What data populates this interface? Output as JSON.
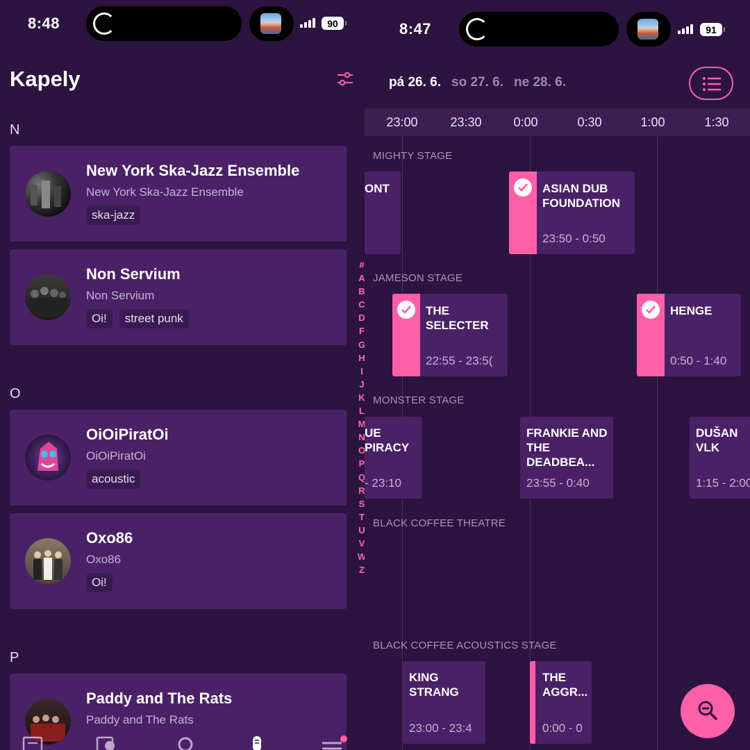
{
  "left": {
    "status": {
      "time": "8:48",
      "battery": "90"
    },
    "title": "Kapely",
    "sections": [
      {
        "letter": "N"
      },
      {
        "letter": "O"
      },
      {
        "letter": "P"
      }
    ],
    "bands": [
      {
        "name": "New York Ska-Jazz Ensemble",
        "subtitle": "New York Ska-Jazz Ensemble",
        "tags": [
          "ska-jazz"
        ]
      },
      {
        "name": "Non Servium",
        "subtitle": "Non Servium",
        "tags": [
          "Oi!",
          "street punk"
        ]
      },
      {
        "name": "OiOiPiratOi",
        "subtitle": "OiOiPiratOi",
        "tags": [
          "acoustic"
        ]
      },
      {
        "name": "Oxo86",
        "subtitle": "Oxo86",
        "tags": [
          "Oi!"
        ]
      },
      {
        "name": "Paddy and The Rats",
        "subtitle": "Paddy and The Rats",
        "tags": []
      }
    ],
    "alphabet": [
      "#",
      "A",
      "B",
      "C",
      "D",
      "F",
      "G",
      "H",
      "I",
      "J",
      "K",
      "L",
      "M",
      "N",
      "O",
      "P",
      "Q",
      "R",
      "S",
      "T",
      "U",
      "V",
      "W",
      "Z"
    ]
  },
  "right": {
    "status": {
      "time": "8:47",
      "battery": "91"
    },
    "days": [
      {
        "label": "pá 26. 6.",
        "active": true
      },
      {
        "label": "so 27. 6.",
        "active": false
      },
      {
        "label": "ne 28. 6.",
        "active": false
      }
    ],
    "ticks": [
      "23:00",
      "23:30",
      "0:00",
      "0:30",
      "1:00",
      "1:30"
    ],
    "stages": [
      "MIGHTY STAGE",
      "JAMESON STAGE",
      "MONSTER STAGE",
      "BLACK COFFEE THEATRE",
      "BLACK COFFEE ACOUSTICS STAGE"
    ],
    "events": [
      {
        "name": "ONT",
        "time": "",
        "selected": false
      },
      {
        "name": "ASIAN DUB\nFOUNDATION",
        "time": "23:50 - 0:50",
        "selected": true
      },
      {
        "name": "THE\nSELECTER",
        "time": "22:55 - 23:5(",
        "selected": true
      },
      {
        "name": "HENGE",
        "time": "0:50 - 1:40",
        "selected": true
      },
      {
        "name": "UE\nPIRACY",
        "time": "- 23:10",
        "selected": false
      },
      {
        "name": "FRANKIE AND\nTHE DEADBEA...",
        "time": "23:55 - 0:40",
        "selected": false
      },
      {
        "name": "DUŠAN VLK",
        "time": "1:15 - 2:00",
        "selected": false
      },
      {
        "name": "KING\nSTRANG",
        "time": "23:00 - 23:4",
        "selected": false
      },
      {
        "name": "THE\nAGGR...",
        "time": "0:00 - 0",
        "selected": false
      }
    ]
  },
  "colors": {
    "background": "#2c1340",
    "card": "#4a2166",
    "accent": "#ff5fa8"
  }
}
